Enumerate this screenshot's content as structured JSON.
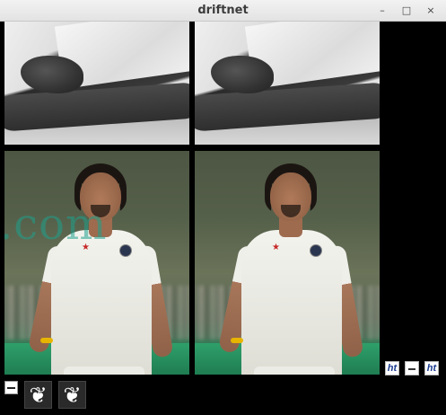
{
  "window": {
    "title": "driftnet",
    "controls": {
      "minimize": "–",
      "maximize": "□",
      "close": "×"
    }
  },
  "canvas": {
    "images": [
      {
        "kind": "photo-bw-hands"
      },
      {
        "kind": "photo-bw-hands"
      },
      {
        "kind": "photo-cricketer",
        "watermark": ".com"
      },
      {
        "kind": "photo-cricketer"
      }
    ],
    "thumbnails": [
      {
        "kind": "ht-logo",
        "text": "ht"
      },
      {
        "kind": "strip-logo"
      },
      {
        "kind": "ht-logo",
        "text": "ht"
      },
      {
        "kind": "white-square"
      },
      {
        "kind": "bird-icon",
        "glyph": "❦"
      },
      {
        "kind": "bird-icon",
        "glyph": "❦"
      }
    ]
  },
  "colors": {
    "background": "#000000",
    "titlebar": "#e8e8e8",
    "title_text": "#3c3c3c"
  }
}
